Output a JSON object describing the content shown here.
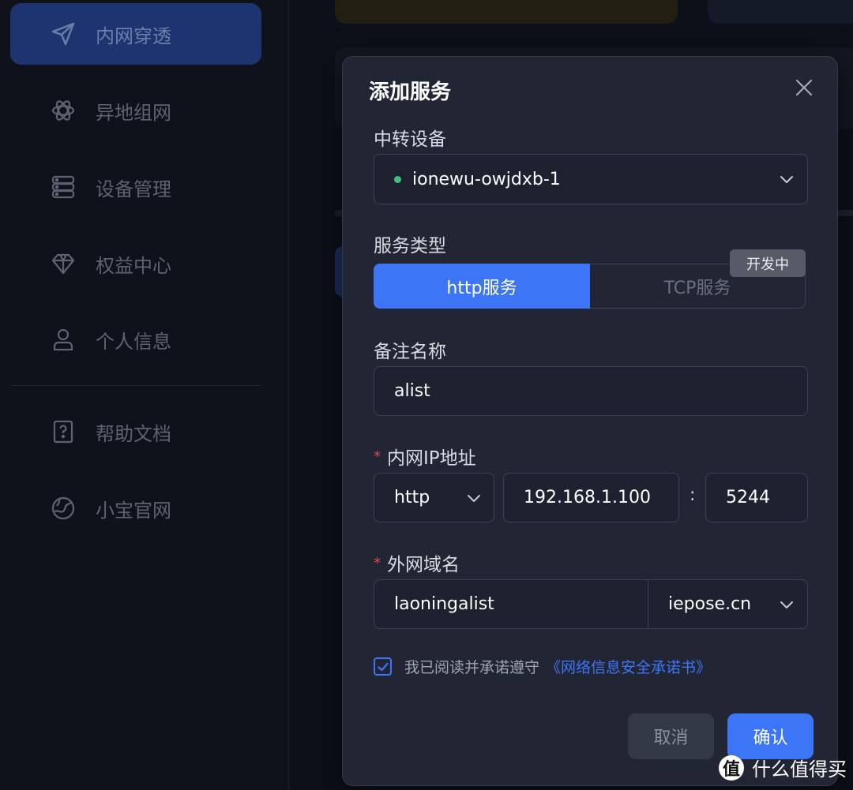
{
  "sidebar": {
    "items": [
      {
        "label": "内网穿透",
        "icon": "send-icon",
        "active": true
      },
      {
        "label": "异地组网",
        "icon": "atom-network-icon",
        "active": false
      },
      {
        "label": "设备管理",
        "icon": "server-icon",
        "active": false
      },
      {
        "label": "权益中心",
        "icon": "diamond-icon",
        "active": false
      },
      {
        "label": "个人信息",
        "icon": "user-icon",
        "active": false
      },
      {
        "label": "帮助文档",
        "icon": "help-book-icon",
        "active": false
      },
      {
        "label": "小宝官网",
        "icon": "globe-icon",
        "active": false
      }
    ]
  },
  "modal": {
    "title": "添加服务",
    "relay_device": {
      "label": "中转设备",
      "value": "ionewu-owjdxb-1",
      "status_color": "#3fbf7f"
    },
    "service_type": {
      "label": "服务类型",
      "options": [
        "http服务",
        "TCP服务"
      ],
      "selected": "http服务",
      "badge": "开发中"
    },
    "note_name": {
      "label": "备注名称",
      "value": "alist"
    },
    "lan_ip": {
      "label": "内网IP地址",
      "required_mark": "*",
      "protocol": "http",
      "ip": "192.168.1.100",
      "separator": ":",
      "port": "5244"
    },
    "wan_domain": {
      "label": "外网域名",
      "required_mark": "*",
      "subdomain": "laoningalist",
      "domain": "iepose.cn"
    },
    "agreement": {
      "checked": true,
      "text": "我已阅读并承诺遵守",
      "link": "《网络信息安全承诺书》"
    },
    "buttons": {
      "cancel": "取消",
      "confirm": "确认"
    }
  },
  "watermark": {
    "logo": "值",
    "text": "什么值得买"
  },
  "colors": {
    "accent": "#3c75f6",
    "required": "#e5484d",
    "online": "#3fbf7f"
  }
}
